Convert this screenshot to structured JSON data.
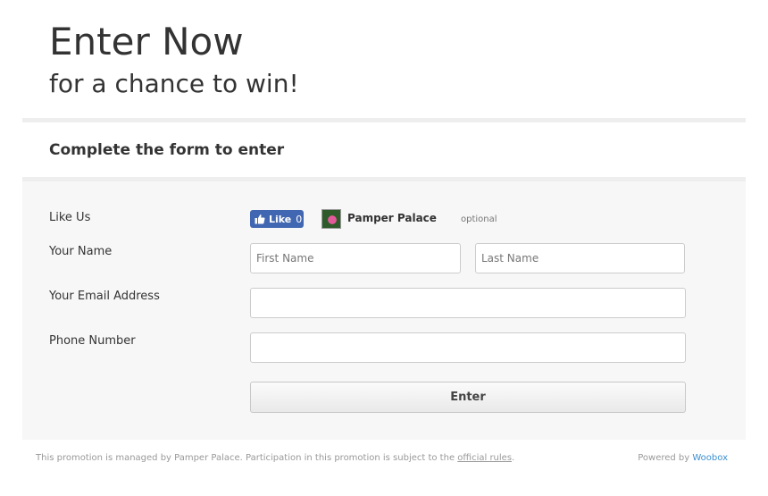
{
  "hero": {
    "title": "Enter Now",
    "subtitle": "for a chance to win!"
  },
  "form": {
    "heading": "Complete the form to enter",
    "like_row": {
      "label": "Like Us",
      "like_button_label": "Like",
      "like_count": "0",
      "page_name": "Pamper Palace",
      "optional_note": "optional"
    },
    "name_row": {
      "label": "Your Name",
      "first_name_placeholder": "First Name",
      "last_name_placeholder": "Last Name"
    },
    "email_row": {
      "label": "Your Email Address",
      "placeholder": ""
    },
    "phone_row": {
      "label": "Phone Number",
      "placeholder": ""
    },
    "submit_label": "Enter"
  },
  "footer": {
    "notice_text": "This promotion is managed by Pamper Palace. Participation in this promotion is subject to the",
    "rules_link": "official rules",
    "notice_end": ".",
    "powered_by_text": "Powered by",
    "powered_by_link": "Woobox"
  },
  "colors": {
    "facebook_blue": "#4267b2",
    "link_blue": "#3b8fd0",
    "panel_background": "#f7f7f7"
  }
}
